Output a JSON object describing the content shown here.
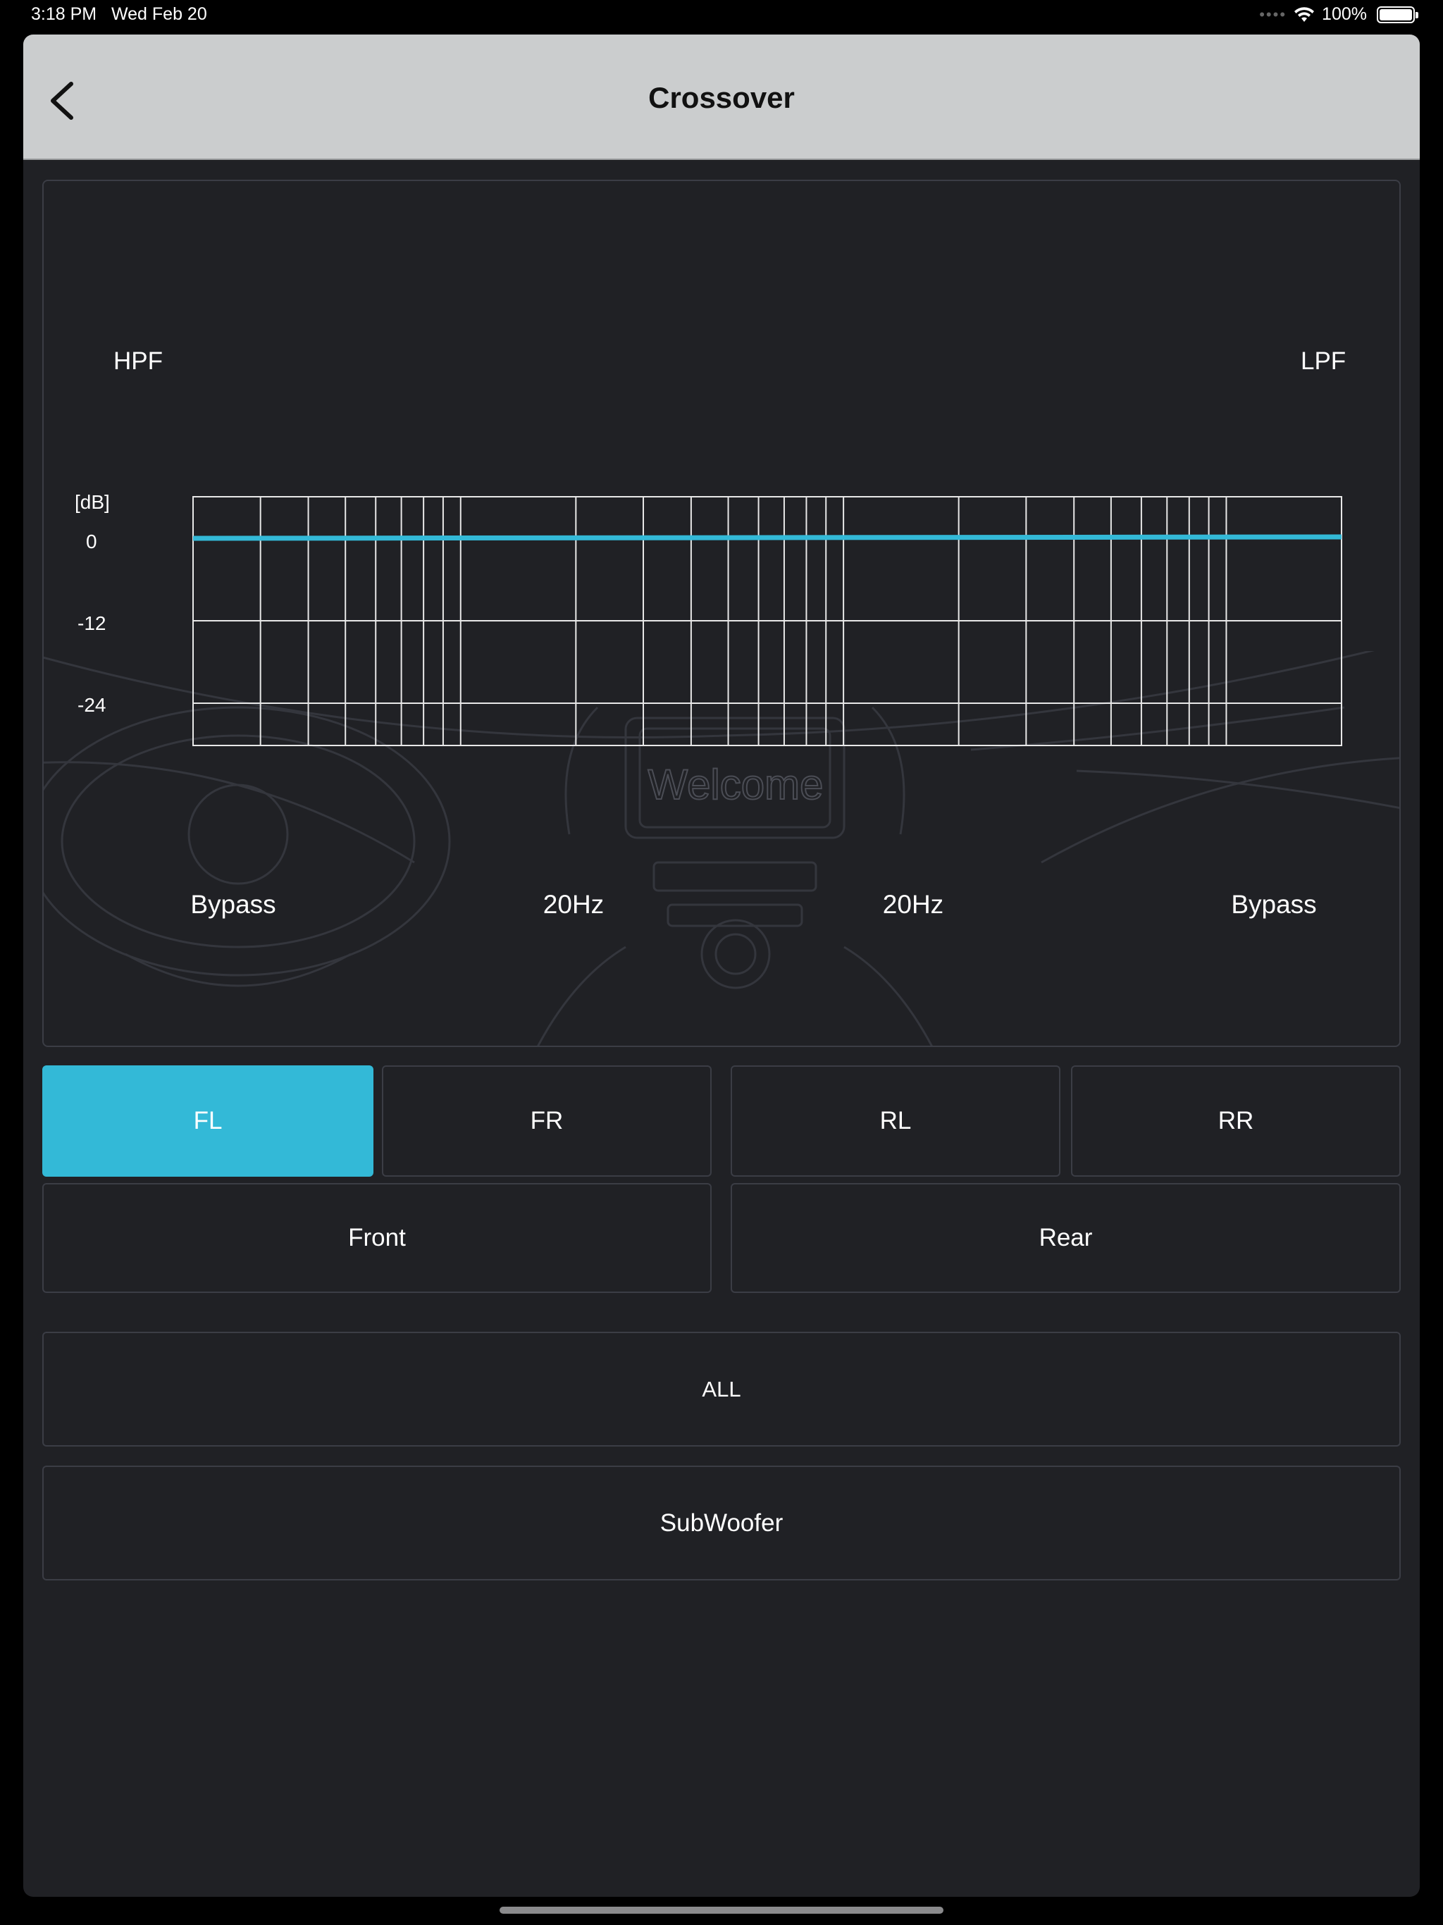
{
  "status_bar": {
    "time": "3:18 PM",
    "date": "Wed Feb 20",
    "battery": "100%"
  },
  "nav": {
    "title": "Crossover",
    "back_icon": "chevron-left-icon"
  },
  "graph": {
    "hpf_label": "HPF",
    "lpf_label": "LPF",
    "y_unit": "[dB]",
    "y_ticks": [
      "0",
      "-12",
      "-24"
    ],
    "curve_color": "#33b9d7",
    "background_text": "Welcome"
  },
  "filters": {
    "hpf_value": "Bypass",
    "hpf_frequency": "20Hz",
    "lpf_frequency": "20Hz",
    "lpf_value": "Bypass"
  },
  "channels": {
    "fl": "FL",
    "fr": "FR",
    "rl": "RL",
    "rr": "RR",
    "front": "Front",
    "rear": "Rear",
    "all": "ALL",
    "subwoofer": "SubWoofer",
    "selected": "FL",
    "accent_color": "#33b9d7"
  }
}
